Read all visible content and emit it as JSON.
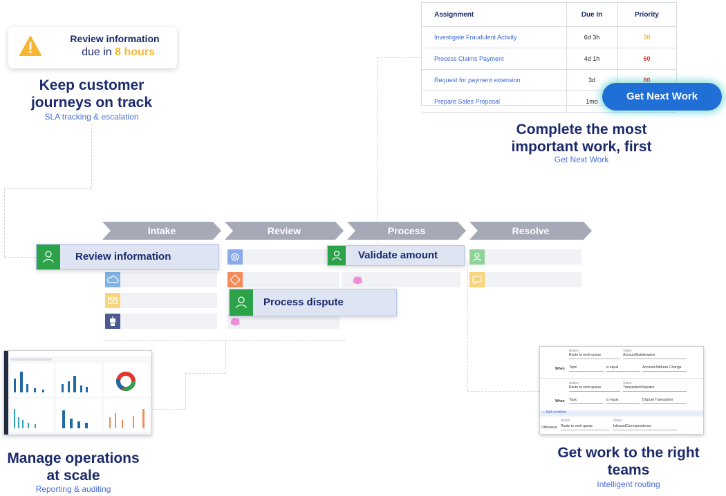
{
  "alert": {
    "title": "Review information",
    "due_prefix": "due in",
    "due_value": "8 hours",
    "icon": "warning-icon",
    "accent": "#f5b731"
  },
  "sla": {
    "heading": "Keep customer journeys on track",
    "sub": "SLA tracking & escalation"
  },
  "table": {
    "columns": [
      "Assignment",
      "Due In",
      "Priority"
    ],
    "rows": [
      {
        "name": "Investigate Fraudulent Activity",
        "due": "6d 3h",
        "priority": "30",
        "color": "#f5b731"
      },
      {
        "name": "Process Claims Payment",
        "due": "4d 1h",
        "priority": "60",
        "color": "#e0352b"
      },
      {
        "name": "Request for payment extension",
        "due": "3d",
        "priority": "80",
        "color": "#e0352b"
      },
      {
        "name": "Prepare Sales Proposal",
        "due": "1mo",
        "priority": "",
        "color": "#e0352b"
      }
    ]
  },
  "get_next": {
    "button": "Get Next Work",
    "heading": "Complete the most important work, first",
    "sub": "Get Next Work",
    "accent": "#1f6fd6"
  },
  "stages": [
    "Intake",
    "Review",
    "Process",
    "Resolve"
  ],
  "steps": {
    "review_info": "Review information",
    "validate_amount": "Validate amount",
    "process_dispute": "Process dispute"
  },
  "reporting": {
    "heading": "Manage operations at scale",
    "sub": "Reporting & auditing"
  },
  "routing": {
    "heading": "Get work to the right teams",
    "sub": "Intelligent routing",
    "labels": {
      "action": "Action",
      "value": "Value",
      "when": "When",
      "otherwise": "Otherwise",
      "add": "+ Add condition"
    },
    "rules": [
      {
        "action": "Route to work queue",
        "value": "AccountMaintenance",
        "field": "Topic",
        "op": "is equal",
        "cond": "Account Address Change"
      },
      {
        "action": "Route to work queue",
        "value": "TransactionDisputes",
        "field": "Topic",
        "op": "is equal",
        "cond": "Dispute Transaction"
      }
    ],
    "otherwise": {
      "action": "Route to work queue",
      "value": "InboundCorrespondence"
    }
  }
}
